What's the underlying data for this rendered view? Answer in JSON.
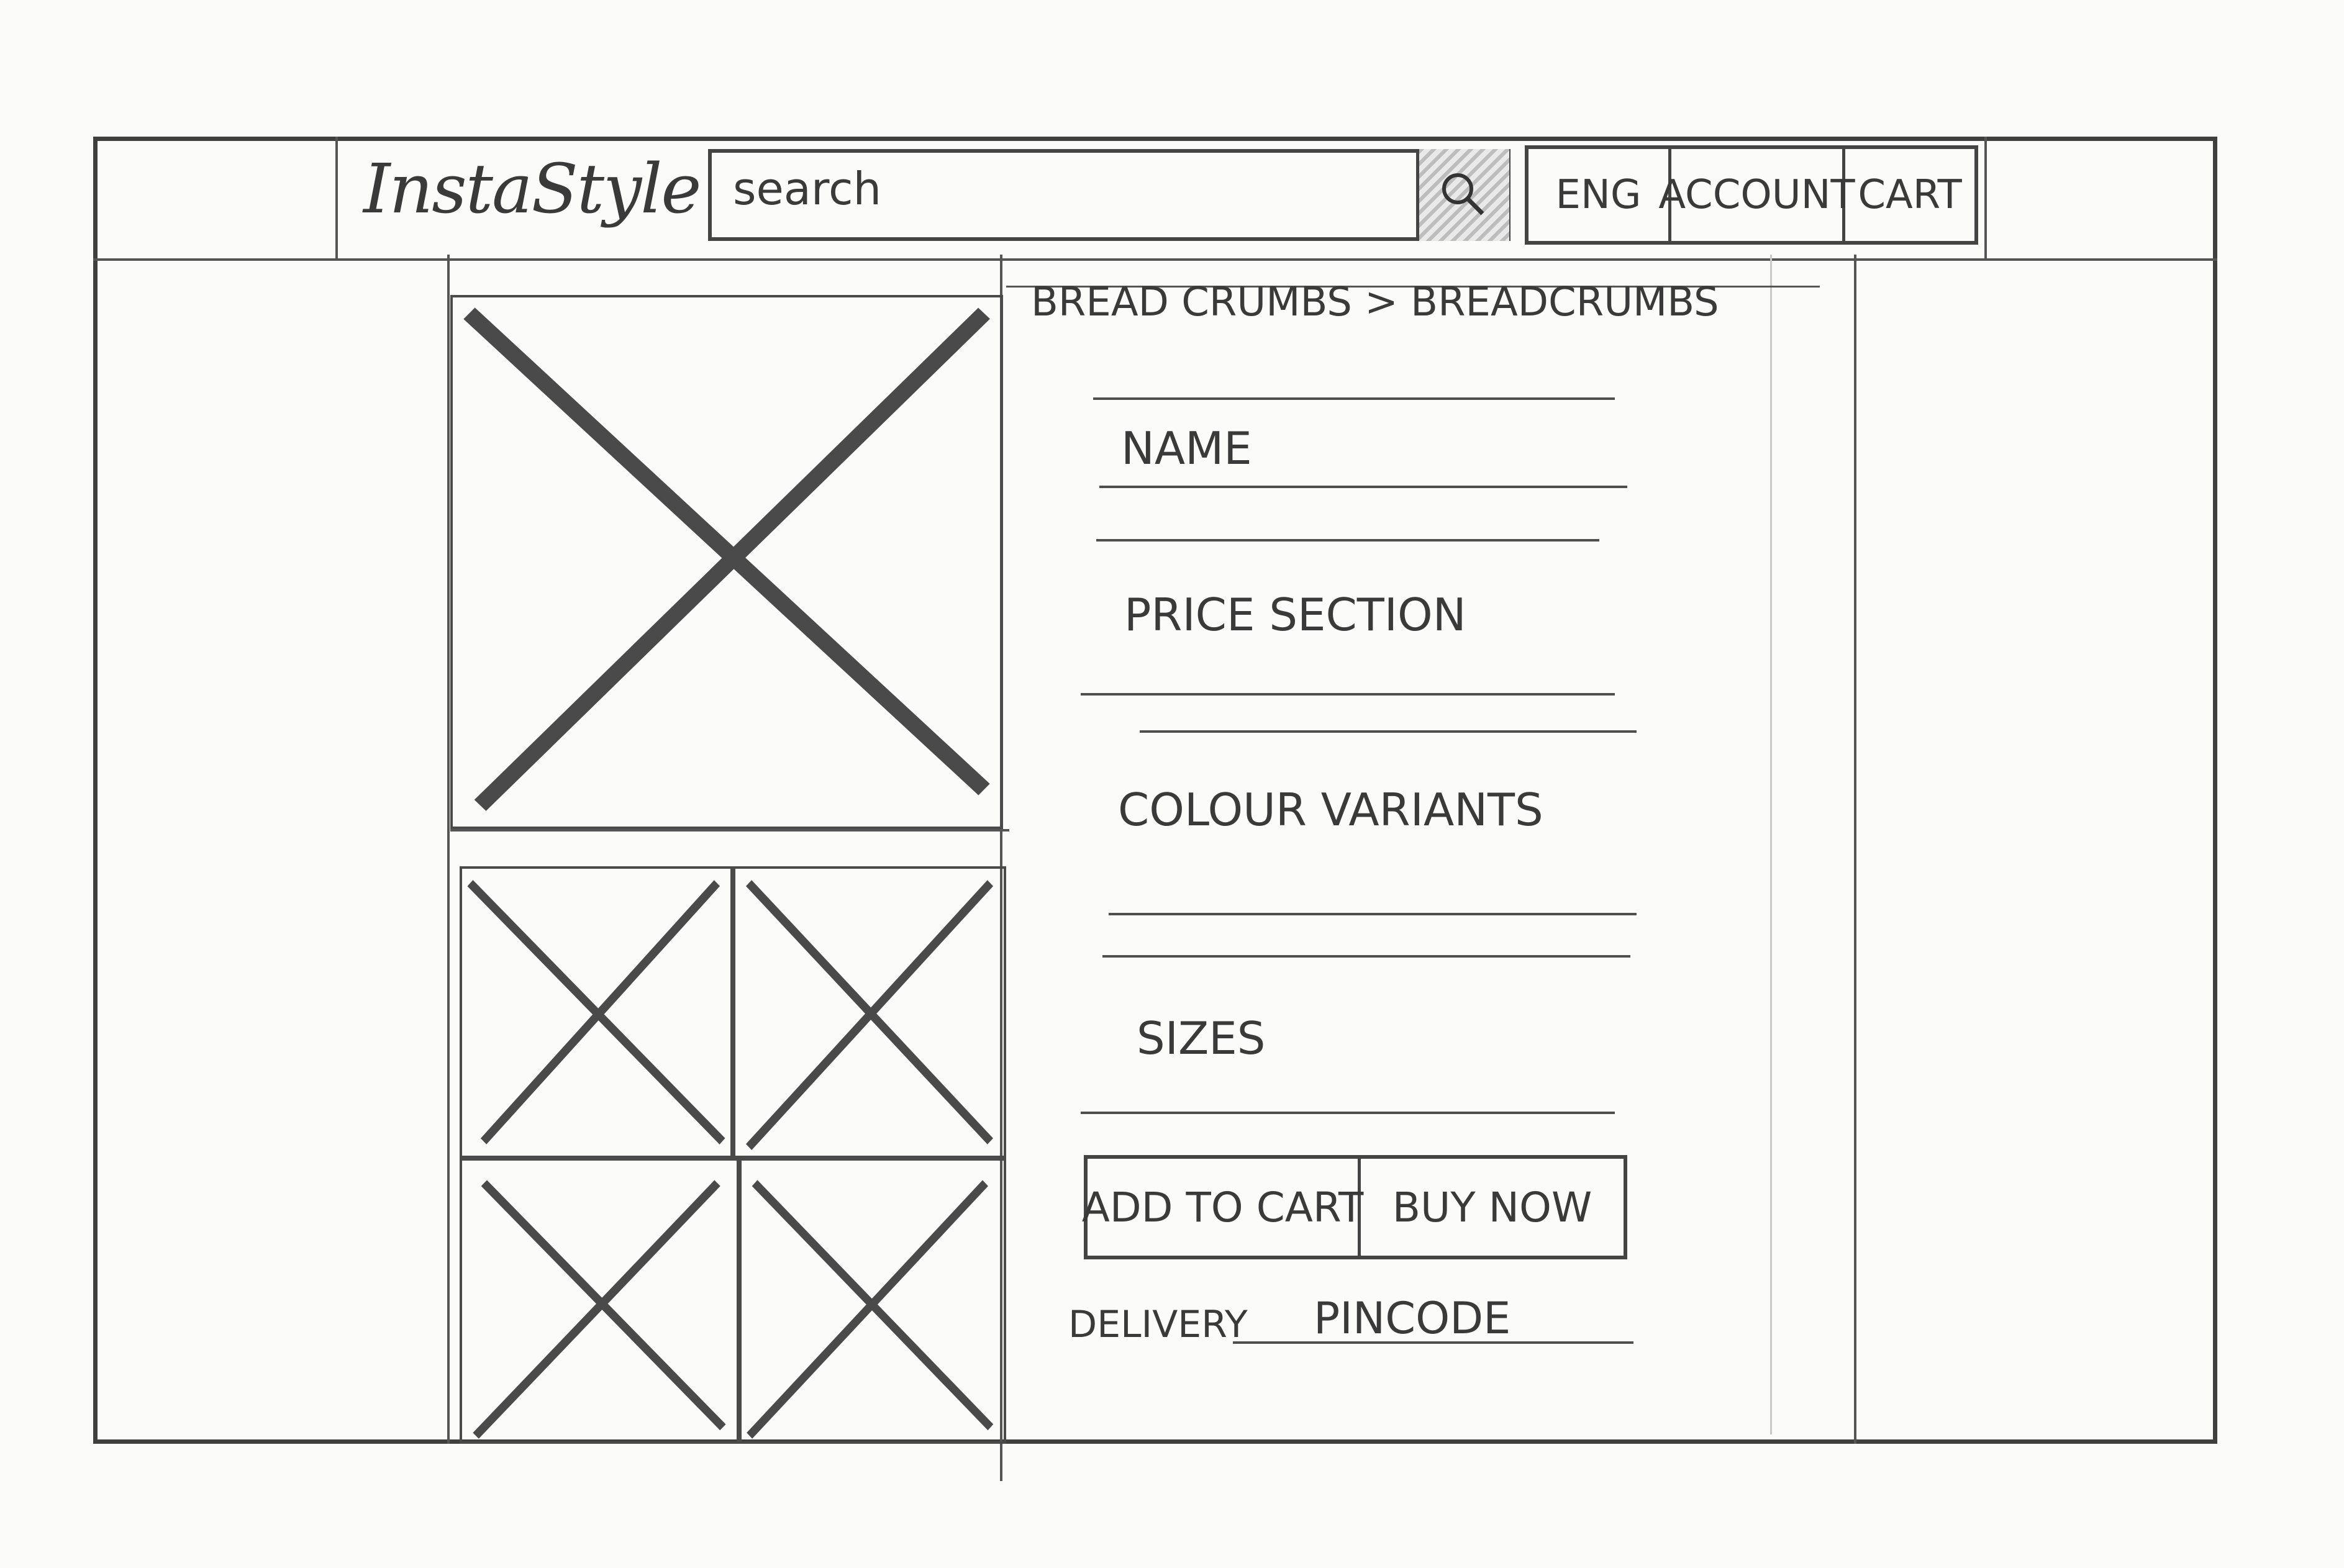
{
  "header": {
    "logo": "InstaStyle",
    "search_placeholder": "search",
    "nav": {
      "language": "ENG",
      "account": "ACCOUNT",
      "cart": "CART"
    }
  },
  "breadcrumbs": "BREAD CRUMBS > BREADCRUMBS",
  "product": {
    "name_label": "NAME",
    "price_label": "PRICE SECTION",
    "colour_label": "COLOUR VARIANTS",
    "sizes_label": "SIZES",
    "add_to_cart": "ADD TO CART",
    "buy_now": "BUY NOW",
    "delivery_label": "DELIVERY",
    "pincode_placeholder": "PINCODE"
  },
  "colors": {
    "paper": "#fbfbf9",
    "ink": "#3a3a3a"
  }
}
